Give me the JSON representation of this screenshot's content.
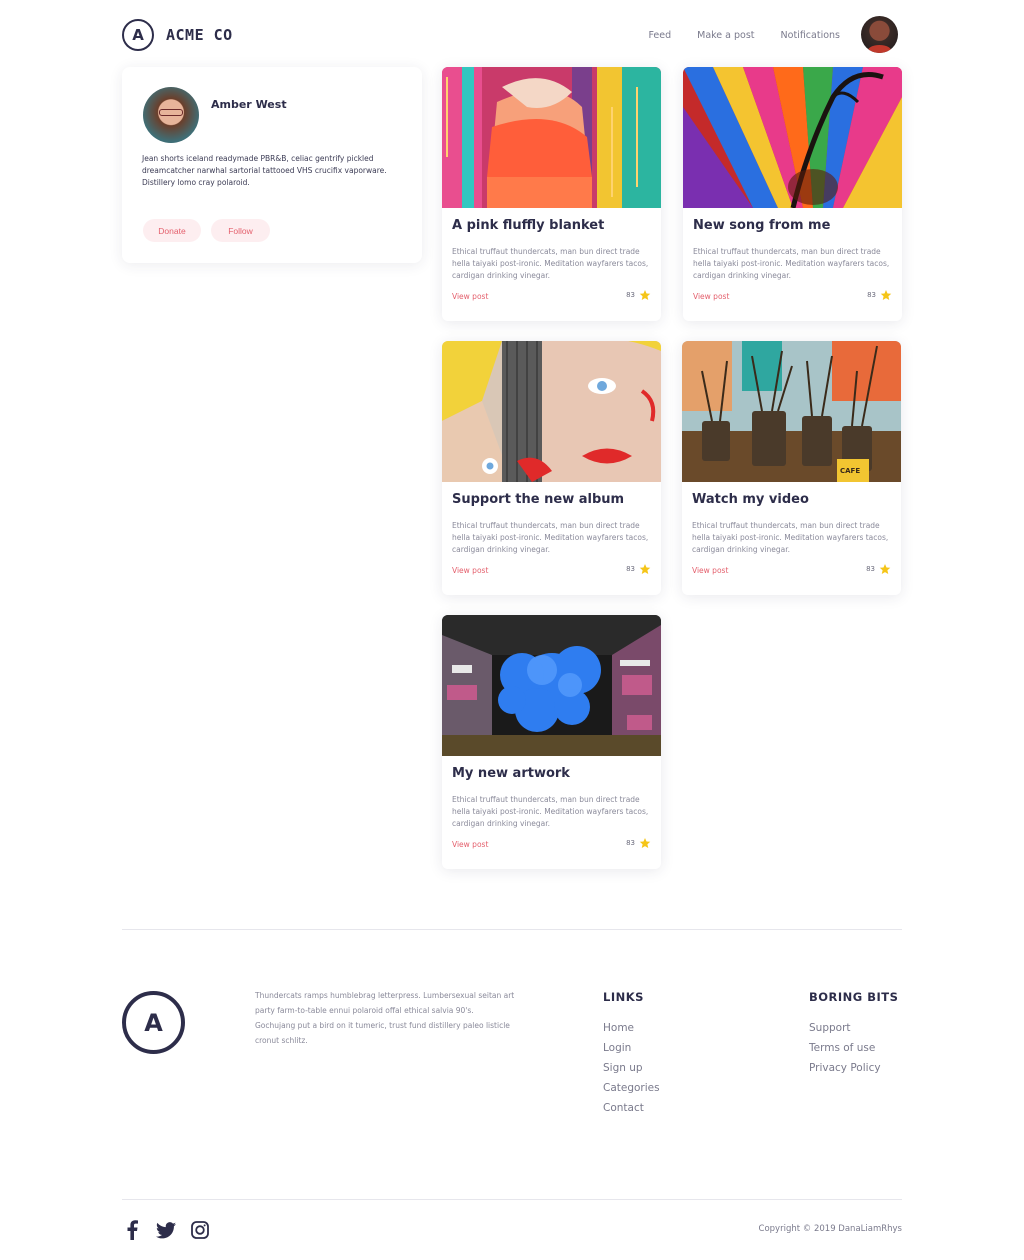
{
  "brand": {
    "name": "ACME CO",
    "logo_letter": "A"
  },
  "nav": [
    {
      "label": "Feed"
    },
    {
      "label": "Make a post"
    },
    {
      "label": "Notifications"
    }
  ],
  "profile": {
    "name": "Amber West",
    "bio": "Jean shorts iceland readymade PBR&B, celiac gentrify pickled dreamcatcher narwhal sartorial tattooed VHS crucifix vaporware. Distillery lomo cray polaroid.",
    "donate_label": "Donate",
    "follow_label": "Follow"
  },
  "posts": [
    {
      "title": "A pink fluffly blanket",
      "description": "Ethical truffaut thundercats, man bun direct trade hella taiyaki post-ironic. Meditation wayfarers tacos, cardigan drinking vinegar.",
      "link": "View post",
      "rating": "83"
    },
    {
      "title": "New song from me",
      "description": "Ethical truffaut thundercats, man bun direct trade hella taiyaki post-ironic. Meditation wayfarers tacos, cardigan drinking vinegar.",
      "link": "View post",
      "rating": "83"
    },
    {
      "title": "Support the new album",
      "description": "Ethical truffaut thundercats, man bun direct trade hella taiyaki post-ironic. Meditation wayfarers tacos, cardigan drinking vinegar.",
      "link": "View post",
      "rating": "83"
    },
    {
      "title": "Watch my video",
      "description": "Ethical truffaut thundercats, man bun direct trade hella taiyaki post-ironic. Meditation wayfarers tacos, cardigan drinking vinegar.",
      "link": "View post",
      "rating": "83"
    },
    {
      "title": "My new artwork",
      "description": "Ethical truffaut thundercats, man bun direct trade hella taiyaki post-ironic. Meditation wayfarers tacos, cardigan drinking vinegar.",
      "link": "View post",
      "rating": "83"
    }
  ],
  "footer": {
    "blurb": "Thundercats ramps humblebrag letterpress. Lumbersexual seitan art party farm-to-table ennui polaroid offal ethical salvia 90's. Gochujang put a bird on it tumeric, trust fund distillery paleo listicle cronut schlitz.",
    "links_heading": "LINKS",
    "links": [
      "Home",
      "Login",
      "Sign up",
      "Categories",
      "Contact"
    ],
    "boring_heading": "BORING BITS",
    "boring": [
      "Support",
      "Terms of use",
      "Privacy Policy"
    ],
    "copyright": "Copyright © 2019 DanaLiamRhys",
    "social_icons": [
      "facebook-icon",
      "twitter-icon",
      "instagram-icon"
    ]
  },
  "colors": {
    "accent": "#e4606d",
    "pill_bg": "#fdeef0",
    "text_dark": "#2d2d4a",
    "star": "#f5c518"
  }
}
